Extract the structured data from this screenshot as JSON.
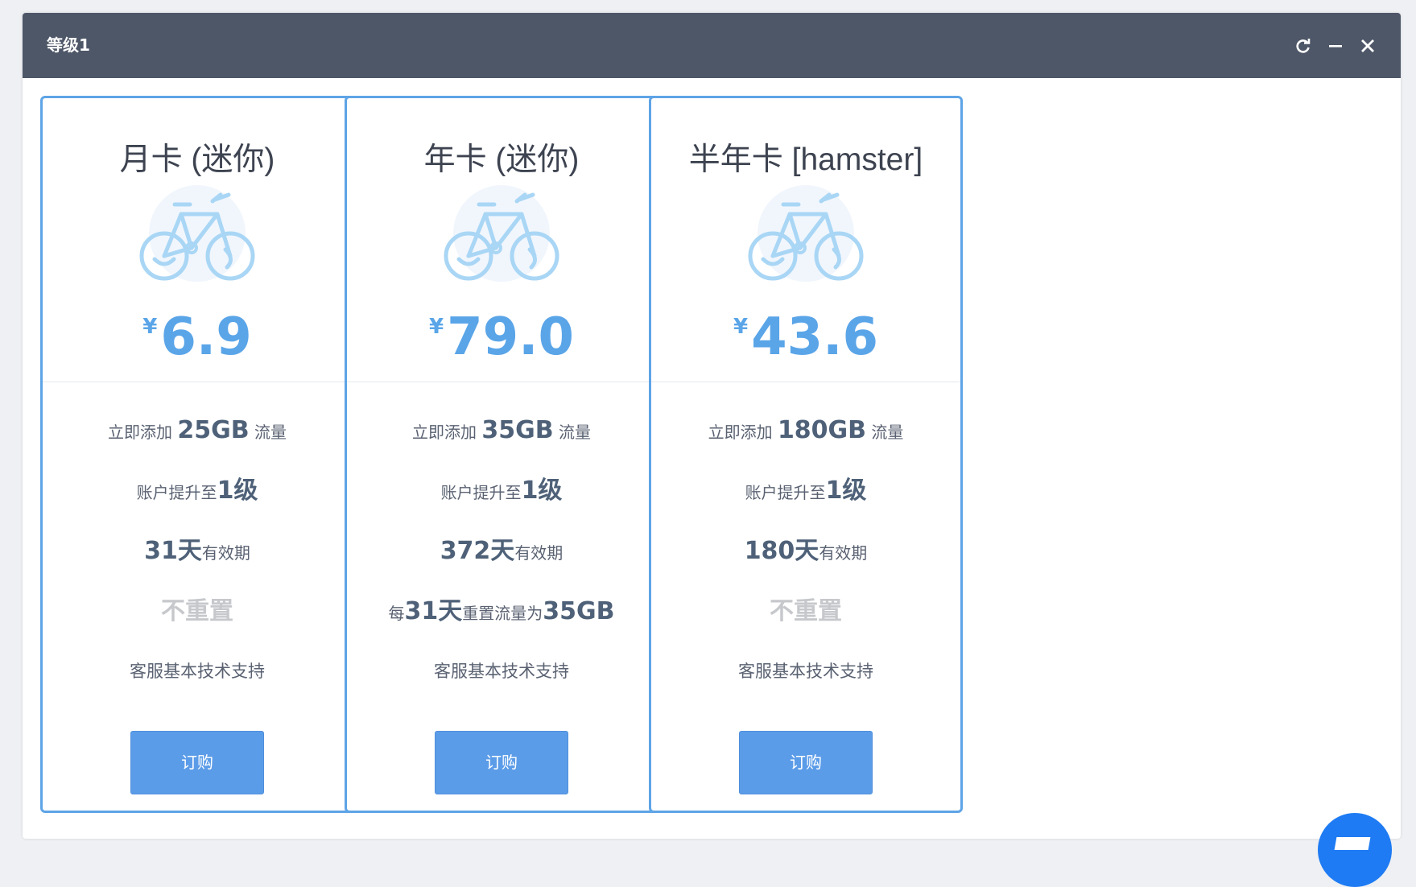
{
  "window": {
    "title": "等级1"
  },
  "titlebar_icons": [
    "refresh-icon",
    "minimize-icon",
    "close-icon"
  ],
  "colors": {
    "accent": "#5ea4e6",
    "button": "#5b9ce8",
    "titlebar": "#4e5768",
    "muted": "#c6c8cc",
    "fab": "#1e7bf3"
  },
  "plans": [
    {
      "title": "月卡 (迷你)",
      "icon": "bicycle-icon",
      "currency": "¥",
      "price": "6.9",
      "traffic_prefix": "立即添加 ",
      "traffic": "25GB",
      "traffic_suffix": " 流量",
      "level_prefix": "账户提升至",
      "level": "1级",
      "days": "31天",
      "days_suffix": "有效期",
      "reset_type": "none",
      "reset_text": "不重置",
      "support": "客服基本技术支持",
      "button": "订购"
    },
    {
      "title": "年卡 (迷你)",
      "icon": "bicycle-icon",
      "currency": "¥",
      "price": "79.0",
      "traffic_prefix": "立即添加 ",
      "traffic": "35GB",
      "traffic_suffix": " 流量",
      "level_prefix": "账户提升至",
      "level": "1级",
      "days": "372天",
      "days_suffix": "有效期",
      "reset_type": "periodic",
      "reset_prefix": "每",
      "reset_period": "31天",
      "reset_mid": "重置流量为",
      "reset_amount": "35GB",
      "support": "客服基本技术支持",
      "button": "订购"
    },
    {
      "title": "半年卡 [hamster]",
      "icon": "bicycle-icon",
      "currency": "¥",
      "price": "43.6",
      "traffic_prefix": "立即添加 ",
      "traffic": "180GB",
      "traffic_suffix": " 流量",
      "level_prefix": "账户提升至",
      "level": "1级",
      "days": "180天",
      "days_suffix": "有效期",
      "reset_type": "none",
      "reset_text": "不重置",
      "support": "客服基本技术支持",
      "button": "订购"
    }
  ]
}
